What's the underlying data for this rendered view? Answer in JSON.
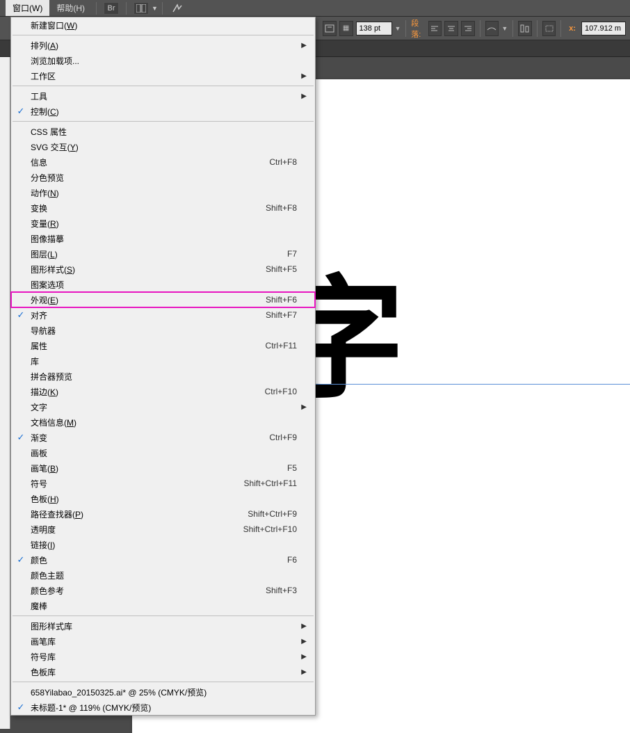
{
  "menubar": {
    "window": "窗口(W)",
    "help": "帮助(H)",
    "br_icon": "Br"
  },
  "controlbar": {
    "pt_value": "138 pt",
    "paragraph_label": "段落:",
    "x_label": "x:",
    "x_value": "107.912 m"
  },
  "canvas": {
    "big_text": "文字"
  },
  "menu": {
    "sections": [
      [
        {
          "label": "新建窗口(W)",
          "check": false,
          "shortcut": "",
          "arrow": false,
          "hl": false
        }
      ],
      [
        {
          "label": "排列(A)",
          "check": false,
          "shortcut": "",
          "arrow": true,
          "hl": false
        },
        {
          "label": "浏览加载项...",
          "check": false,
          "shortcut": "",
          "arrow": false,
          "hl": false
        },
        {
          "label": "工作区",
          "check": false,
          "shortcut": "",
          "arrow": true,
          "hl": false
        }
      ],
      [
        {
          "label": "工具",
          "check": false,
          "shortcut": "",
          "arrow": true,
          "hl": false
        },
        {
          "label": "控制(C)",
          "check": true,
          "shortcut": "",
          "arrow": false,
          "hl": false
        }
      ],
      [
        {
          "label": "CSS 属性",
          "check": false,
          "shortcut": "",
          "arrow": false,
          "hl": false
        },
        {
          "label": "SVG 交互(Y)",
          "check": false,
          "shortcut": "",
          "arrow": false,
          "hl": false
        },
        {
          "label": "信息",
          "check": false,
          "shortcut": "Ctrl+F8",
          "arrow": false,
          "hl": false
        },
        {
          "label": "分色预览",
          "check": false,
          "shortcut": "",
          "arrow": false,
          "hl": false
        },
        {
          "label": "动作(N)",
          "check": false,
          "shortcut": "",
          "arrow": false,
          "hl": false
        },
        {
          "label": "变换",
          "check": false,
          "shortcut": "Shift+F8",
          "arrow": false,
          "hl": false
        },
        {
          "label": "变量(R)",
          "check": false,
          "shortcut": "",
          "arrow": false,
          "hl": false
        },
        {
          "label": "图像描摹",
          "check": false,
          "shortcut": "",
          "arrow": false,
          "hl": false
        },
        {
          "label": "图层(L)",
          "check": false,
          "shortcut": "F7",
          "arrow": false,
          "hl": false
        },
        {
          "label": "图形样式(S)",
          "check": false,
          "shortcut": "Shift+F5",
          "arrow": false,
          "hl": false
        },
        {
          "label": "图案选项",
          "check": false,
          "shortcut": "",
          "arrow": false,
          "hl": false
        },
        {
          "label": "外观(E)",
          "check": false,
          "shortcut": "Shift+F6",
          "arrow": false,
          "hl": true
        },
        {
          "label": "对齐",
          "check": true,
          "shortcut": "Shift+F7",
          "arrow": false,
          "hl": false
        },
        {
          "label": "导航器",
          "check": false,
          "shortcut": "",
          "arrow": false,
          "hl": false
        },
        {
          "label": "属性",
          "check": false,
          "shortcut": "Ctrl+F11",
          "arrow": false,
          "hl": false
        },
        {
          "label": "库",
          "check": false,
          "shortcut": "",
          "arrow": false,
          "hl": false
        },
        {
          "label": "拼合器预览",
          "check": false,
          "shortcut": "",
          "arrow": false,
          "hl": false
        },
        {
          "label": "描边(K)",
          "check": false,
          "shortcut": "Ctrl+F10",
          "arrow": false,
          "hl": false
        },
        {
          "label": "文字",
          "check": false,
          "shortcut": "",
          "arrow": true,
          "hl": false
        },
        {
          "label": "文档信息(M)",
          "check": false,
          "shortcut": "",
          "arrow": false,
          "hl": false
        },
        {
          "label": "渐变",
          "check": true,
          "shortcut": "Ctrl+F9",
          "arrow": false,
          "hl": false
        },
        {
          "label": "画板",
          "check": false,
          "shortcut": "",
          "arrow": false,
          "hl": false
        },
        {
          "label": "画笔(B)",
          "check": false,
          "shortcut": "F5",
          "arrow": false,
          "hl": false
        },
        {
          "label": "符号",
          "check": false,
          "shortcut": "Shift+Ctrl+F11",
          "arrow": false,
          "hl": false
        },
        {
          "label": "色板(H)",
          "check": false,
          "shortcut": "",
          "arrow": false,
          "hl": false
        },
        {
          "label": "路径查找器(P)",
          "check": false,
          "shortcut": "Shift+Ctrl+F9",
          "arrow": false,
          "hl": false
        },
        {
          "label": "透明度",
          "check": false,
          "shortcut": "Shift+Ctrl+F10",
          "arrow": false,
          "hl": false
        },
        {
          "label": "链接(I)",
          "check": false,
          "shortcut": "",
          "arrow": false,
          "hl": false
        },
        {
          "label": "颜色",
          "check": true,
          "shortcut": "F6",
          "arrow": false,
          "hl": false
        },
        {
          "label": "颜色主题",
          "check": false,
          "shortcut": "",
          "arrow": false,
          "hl": false
        },
        {
          "label": "颜色参考",
          "check": false,
          "shortcut": "Shift+F3",
          "arrow": false,
          "hl": false
        },
        {
          "label": "魔棒",
          "check": false,
          "shortcut": "",
          "arrow": false,
          "hl": false
        }
      ],
      [
        {
          "label": "图形样式库",
          "check": false,
          "shortcut": "",
          "arrow": true,
          "hl": false
        },
        {
          "label": "画笔库",
          "check": false,
          "shortcut": "",
          "arrow": true,
          "hl": false
        },
        {
          "label": "符号库",
          "check": false,
          "shortcut": "",
          "arrow": true,
          "hl": false
        },
        {
          "label": "色板库",
          "check": false,
          "shortcut": "",
          "arrow": true,
          "hl": false
        }
      ],
      [
        {
          "label": "658Yilabao_20150325.ai* @ 25% (CMYK/预览)",
          "check": false,
          "shortcut": "",
          "arrow": false,
          "hl": false
        },
        {
          "label": "未标题-1* @ 119% (CMYK/预览)",
          "check": true,
          "shortcut": "",
          "arrow": false,
          "hl": false
        }
      ]
    ]
  }
}
